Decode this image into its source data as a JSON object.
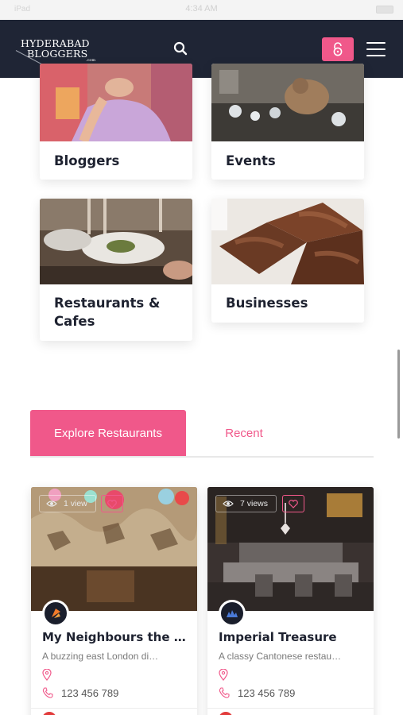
{
  "status_bar": {
    "time": "4:34 AM",
    "left": "iPad"
  },
  "nav": {
    "logo_line1": "HYDERABAD",
    "logo_line2": "BLOGGERS",
    "logo_sub": ".com"
  },
  "categories": [
    {
      "label": "Bloggers"
    },
    {
      "label": "Events"
    },
    {
      "label": "Restaurants &",
      "label2": "Cafes"
    },
    {
      "label": "Businesses"
    }
  ],
  "tabs": {
    "active": "Explore Restaurants",
    "second": "Recent"
  },
  "restaurants": [
    {
      "views": "1 view",
      "title": "My Neighbours the …",
      "description": "A buzzing east London di…",
      "phone": "123 456 789"
    },
    {
      "views": "7 views",
      "title": "Imperial Treasure",
      "description": "A classy Cantonese restau…",
      "phone": "123 456 789"
    }
  ],
  "colors": {
    "accent": "#f0588a",
    "nav_bg": "#1f2535"
  }
}
